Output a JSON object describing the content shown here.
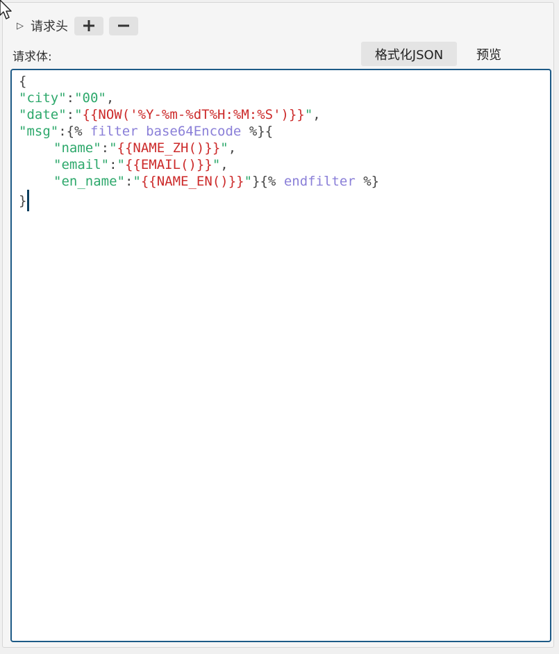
{
  "headers_section": {
    "toggle_icon": "triangle-right-icon",
    "label": "请求头",
    "add_icon": "plus-icon",
    "remove_icon": "minus-icon"
  },
  "body_section": {
    "label": "请求体:",
    "format_button": "格式化JSON",
    "preview_button": "预览"
  },
  "editor": {
    "lines": [
      {
        "open": "{"
      },
      {
        "key": "\"city\"",
        "colon": ":",
        "value": "\"00\"",
        "end": ","
      },
      {
        "key": "\"date\"",
        "colon": ":",
        "q1": "\"",
        "tmpl": "{{NOW('%Y-%m-%dT%H:%M:%S')}}",
        "q2": "\"",
        "end": ","
      },
      {
        "key": "\"msg\"",
        "colon": ":",
        "tag_open": "{%",
        "kw1": "filter",
        "kw2": "base64Encode",
        "tag_close": "%}",
        "brace": "{"
      },
      {
        "key": "\"name\"",
        "colon": ":",
        "q1": "\"",
        "tmpl": "{{NAME_ZH()}}",
        "q2": "\"",
        "end": ","
      },
      {
        "key": "\"email\"",
        "colon": ":",
        "q1": "\"",
        "tmpl": "{{EMAIL()}}",
        "q2": "\"",
        "end": ","
      },
      {
        "key": "\"en_name\"",
        "colon": ":",
        "q1": "\"",
        "tmpl": "{{NAME_EN()}}",
        "q2": "\"",
        "brace": "}",
        "tag_open": "{%",
        "kw": "endfilter",
        "tag_close": "%}"
      },
      {
        "close": "}"
      }
    ]
  },
  "colors": {
    "key": "#2da86b",
    "template": "#cc2a2a",
    "keyword": "#8a7fd8",
    "editor_border": "#1d5a86"
  }
}
